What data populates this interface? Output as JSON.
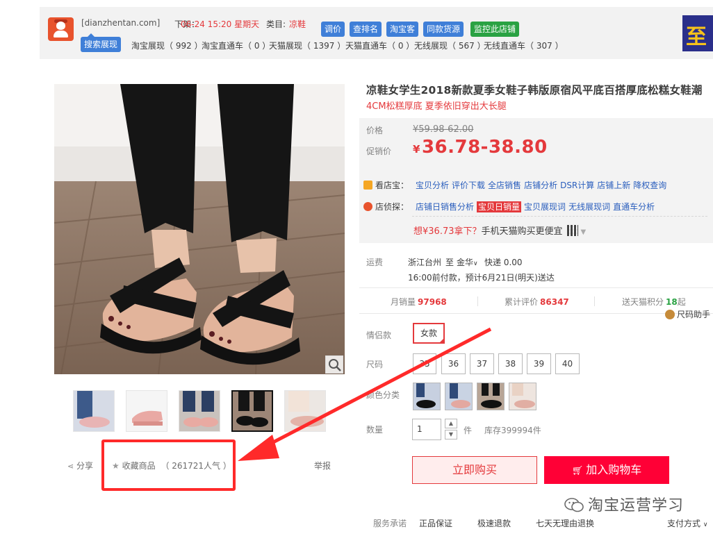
{
  "plugin_bar": {
    "site": "[dianzhentan.com]",
    "listed_label": "下架：",
    "listed_time": "06-24 15:20 星期天",
    "category_label": "类目:",
    "category": "凉鞋",
    "buttons": [
      "调价",
      "查排名",
      "淘宝客",
      "同款货源",
      "监控此店铺"
    ],
    "search_tag": "搜索展现",
    "stats": [
      {
        "label": "淘宝展现",
        "value": "992"
      },
      {
        "label": "淘宝直通车",
        "value": "0"
      },
      {
        "label": "天猫展现",
        "value": "1397"
      },
      {
        "label": "天猫直通车",
        "value": "0"
      },
      {
        "label": "无线展现",
        "value": "567"
      },
      {
        "label": "无线直通车",
        "value": "307"
      }
    ],
    "corner_ad_text": "至"
  },
  "product": {
    "title": "凉鞋女学生2018新款夏季女鞋子韩版原宿风平底百搭厚底松糕女鞋潮",
    "subtitle": "4CM松糕厚底 夏季依旧穿出大长腿",
    "price_label": "价格",
    "price_original": "¥59.98-62.00",
    "promo_label": "促销价",
    "promo_currency": "¥",
    "promo_price": "36.78-38.80",
    "kandianbao": {
      "label": "看店宝：",
      "links": [
        "宝贝分析",
        "评价下载",
        "全店销售",
        "店铺分析",
        "DSR计算",
        "店铺上新",
        "降权查询"
      ]
    },
    "dianzhentan": {
      "label": "店侦探：",
      "links": [
        "店铺日销售分析",
        "宝贝日销量",
        "宝贝展现词",
        "无线展现词",
        "直通车分析"
      ],
      "highlight_index": 1
    },
    "tmall_tip_prefix": "想",
    "tmall_tip_price": "¥36.73拿下？",
    "tmall_tip_suffix": "手机天猫购买更便宜",
    "shipping_label": "运费",
    "shipping_from": "浙江台州",
    "shipping_to_word": "至",
    "shipping_dest": "金华",
    "shipping_method": "快递 0.00",
    "shipping_note": "16:00前付款，预计6月21日(明天)送达",
    "monthly_sales_label": "月销量",
    "monthly_sales": "97968",
    "reviews_label": "累计评价",
    "reviews": "86347",
    "points_label": "送天猫积分",
    "points": "18",
    "points_suffix": "起",
    "size_helper": "尺码助手",
    "style_label": "情侣款",
    "style_option": "女款",
    "size_label": "尺码",
    "sizes": [
      "35",
      "36",
      "37",
      "38",
      "39",
      "40"
    ],
    "color_label": "颜色分类",
    "qty_label": "数量",
    "qty_value": "1",
    "qty_unit": "件",
    "stock": "库存399994件",
    "buy_now": "立即购买",
    "add_cart": "加入购物车",
    "service_label": "服务承诺",
    "services": [
      "正品保证",
      "极速退款",
      "七天无理由退换"
    ],
    "payment_label": "支付方式"
  },
  "gallery": {
    "share": "分享",
    "favorite": "收藏商品",
    "popularity": "（ 261721人气 ）",
    "report": "举报"
  },
  "watermark": "淘宝运营学习",
  "colors": {
    "accent_red": "#e4393c",
    "tmall_red": "#ff0036",
    "plugin_blue": "#3f7fd8",
    "plugin_green": "#2aa243",
    "link_blue": "#2a5ebd"
  }
}
